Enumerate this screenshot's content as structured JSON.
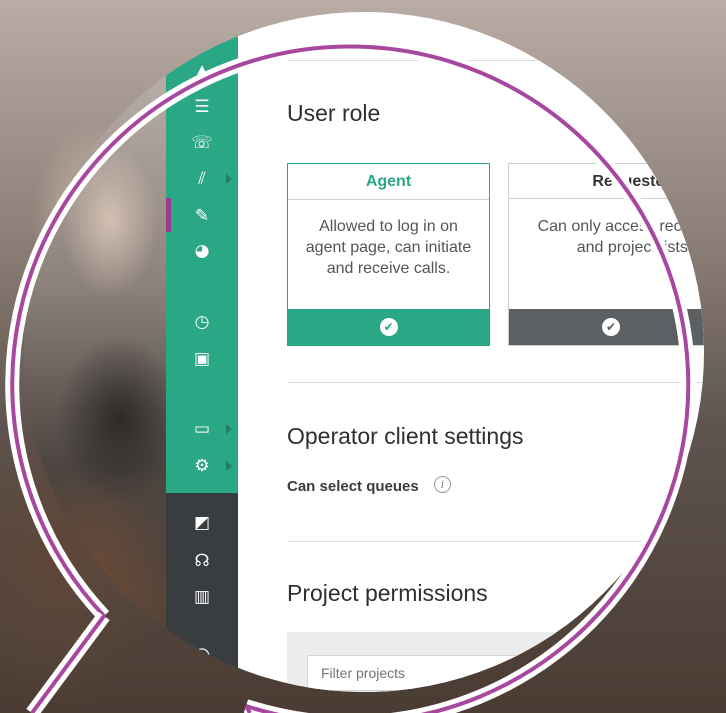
{
  "colors": {
    "accent": "#2aa785",
    "sidebar_dark": "#3a3d40",
    "active_marker": "#9b3b8f",
    "callout_ring": "#a8479f",
    "unselected_footer": "#5d6063"
  },
  "sidebar": {
    "green_items": [
      {
        "icon": "partial-icon",
        "has_arrow": true
      },
      {
        "icon": "contacts-list-icon",
        "has_arrow": false
      },
      {
        "icon": "dial-icon",
        "has_arrow": false
      },
      {
        "icon": "statistics-icon",
        "has_arrow": true
      },
      {
        "icon": "user-edit-icon",
        "has_arrow": false,
        "active": true
      },
      {
        "icon": "chat-globe-icon",
        "has_arrow": false
      },
      {
        "icon": "chat-clock-icon",
        "has_arrow": false
      },
      {
        "icon": "text-box-icon",
        "has_arrow": false
      },
      {
        "icon": "money-icon",
        "has_arrow": true
      },
      {
        "icon": "gear-icon",
        "has_arrow": true
      }
    ],
    "dark_items": [
      {
        "icon": "monitor-chart-icon"
      },
      {
        "icon": "headset-icon"
      },
      {
        "icon": "bar-chart-icon"
      },
      {
        "icon": "user-icon"
      }
    ]
  },
  "user_role": {
    "heading": "User role",
    "cards": [
      {
        "title": "Agent",
        "description": "Allowed to log in on agent page, can initiate and receive calls.",
        "selected": true
      },
      {
        "title": "Requester",
        "description": "Can only access recording- and project lists.",
        "selected": false
      }
    ]
  },
  "operator_settings": {
    "heading": "Operator client settings",
    "can_select_queues_label": "Can select queues",
    "info_glyph": "i"
  },
  "project_permissions": {
    "heading": "Project permissions",
    "filter_placeholder": "Filter projects"
  }
}
